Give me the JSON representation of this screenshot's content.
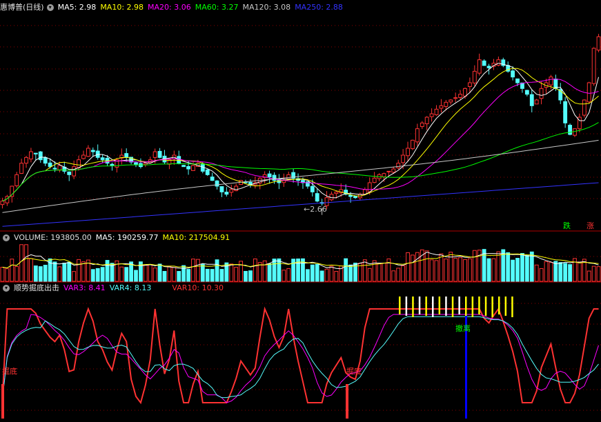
{
  "main": {
    "title": "惠博普(日线)",
    "ma": [
      {
        "label": "MA5: 2.98",
        "color": "#ffffff"
      },
      {
        "label": "MA10: 2.98",
        "color": "#ffff00"
      },
      {
        "label": "MA20: 3.06",
        "color": "#ff00ff"
      },
      {
        "label": "MA60: 3.27",
        "color": "#00ff00"
      },
      {
        "label": "MA120: 3.08",
        "color": "#c8c8c8"
      },
      {
        "label": "MA250: 2.88",
        "color": "#3333ff"
      }
    ],
    "low_label": "2.66",
    "btn_down": "跌",
    "btn_up": "涨"
  },
  "volume": {
    "title": "VOLUME: 193805.00",
    "ma5": "MA5: 190259.77",
    "ma10": "MA10: 217504.91"
  },
  "indicator": {
    "title": "顺势掘底出击",
    "var3": "VAR3: 8.41",
    "var4": "VAR4: 8.13",
    "var10": "VAR10: 10.30",
    "label_dig1": "掘底",
    "label_dig2": "掘底",
    "label_exit": "撤离"
  },
  "colors": {
    "up": "#ff3232",
    "down": "#54fcfc",
    "ma5": "#ffffff",
    "ma10": "#ffff00",
    "ma20": "#ff00ff",
    "ma60": "#00ff00",
    "ma120": "#c8c8c8",
    "ma250": "#3333ff",
    "grid": "#8b0000",
    "exit_line": "#0000ff"
  },
  "chart_data": {
    "type": "candlestick",
    "price_ylim": [
      2.55,
      4.35
    ],
    "low_marker": 2.66,
    "closes": [
      2.72,
      2.76,
      2.85,
      2.95,
      3.05,
      3.1,
      3.15,
      3.13,
      3.08,
      3.05,
      3.02,
      3.0,
      3.03,
      2.98,
      2.95,
      3.02,
      3.08,
      3.12,
      3.18,
      3.15,
      3.1,
      3.08,
      3.05,
      3.03,
      3.08,
      3.12,
      3.1,
      3.06,
      3.04,
      3.02,
      3.05,
      3.08,
      3.15,
      3.1,
      3.06,
      3.08,
      3.12,
      3.05,
      3.02,
      3.0,
      3.03,
      3.05,
      2.98,
      2.95,
      2.9,
      2.85,
      2.8,
      2.78,
      2.82,
      2.85,
      2.9,
      2.88,
      2.86,
      2.88,
      2.92,
      2.95,
      2.93,
      2.9,
      2.88,
      2.9,
      2.95,
      2.92,
      2.9,
      2.88,
      2.85,
      2.8,
      2.72,
      2.7,
      2.75,
      2.78,
      2.8,
      2.82,
      2.78,
      2.76,
      2.75,
      2.78,
      2.82,
      2.88,
      2.92,
      2.95,
      2.96,
      2.98,
      3.0,
      3.05,
      3.12,
      3.18,
      3.25,
      3.35,
      3.4,
      3.45,
      3.48,
      3.52,
      3.55,
      3.58,
      3.6,
      3.62,
      3.65,
      3.7,
      3.75,
      3.85,
      3.95,
      3.9,
      3.88,
      3.92,
      3.95,
      3.9,
      3.85,
      3.8,
      3.75,
      3.7,
      3.65,
      3.55,
      3.6,
      3.7,
      3.75,
      3.8,
      3.7,
      3.6,
      3.4,
      3.3,
      3.35,
      3.45,
      3.6,
      3.75,
      4.05,
      4.15
    ],
    "indicator_levels": [
      8.41,
      8.13,
      10.3
    ]
  }
}
